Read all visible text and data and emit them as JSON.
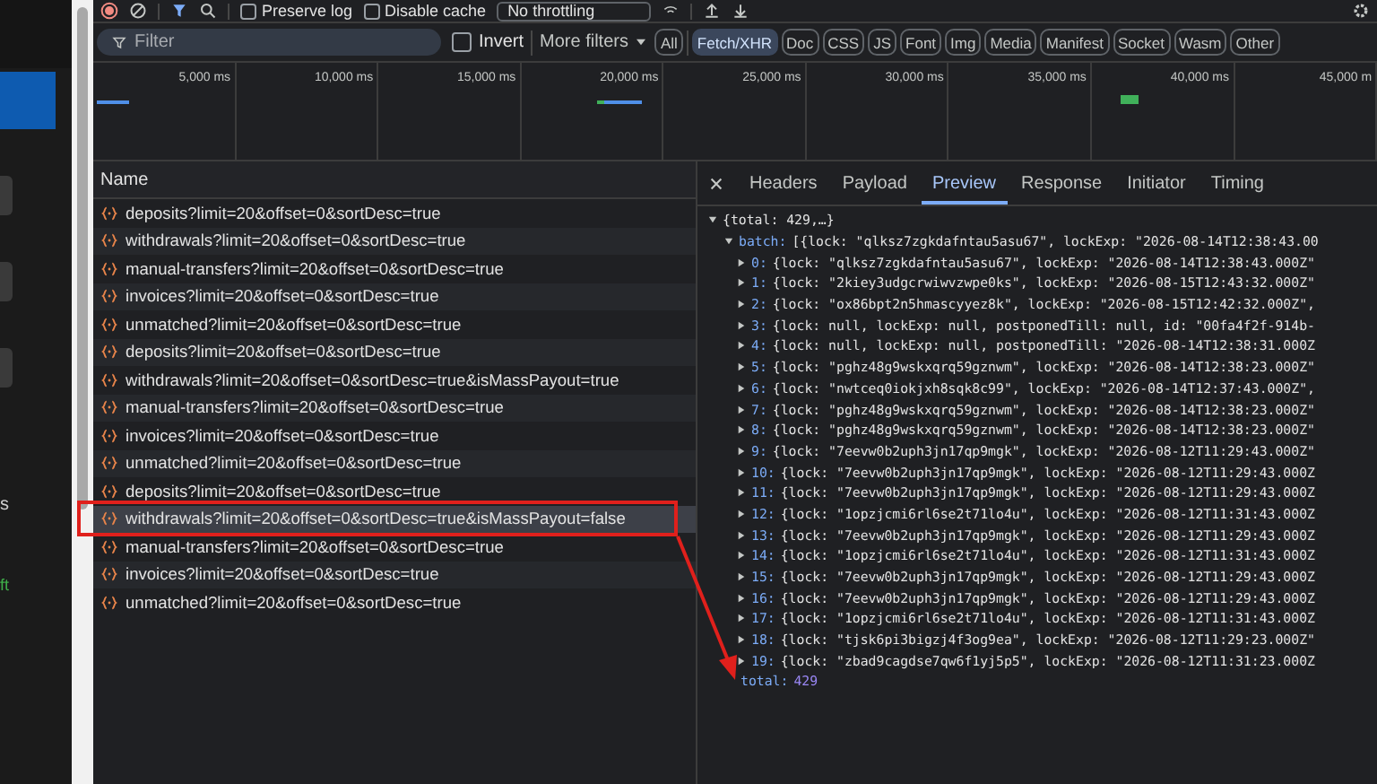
{
  "page_behind": {
    "texts": [
      "s",
      "ft"
    ]
  },
  "toolbar": {
    "checkboxes": [
      {
        "label": "Preserve log",
        "checked": false
      },
      {
        "label": "Disable cache",
        "checked": false
      }
    ],
    "throttling": "No throttling"
  },
  "filter_bar": {
    "placeholder": "Filter",
    "invert": {
      "label": "Invert",
      "checked": false
    },
    "more_filters": "More filters",
    "types": [
      {
        "label": "All",
        "selected": false
      },
      {
        "label": "Fetch/XHR",
        "selected": true
      },
      {
        "label": "Doc",
        "selected": false
      },
      {
        "label": "CSS",
        "selected": false
      },
      {
        "label": "JS",
        "selected": false
      },
      {
        "label": "Font",
        "selected": false
      },
      {
        "label": "Img",
        "selected": false
      },
      {
        "label": "Media",
        "selected": false
      },
      {
        "label": "Manifest",
        "selected": false
      },
      {
        "label": "Socket",
        "selected": false
      },
      {
        "label": "Wasm",
        "selected": false
      },
      {
        "label": "Other",
        "selected": false
      }
    ]
  },
  "timeline": {
    "ticks": [
      "5,000 ms",
      "10,000 ms",
      "15,000 ms",
      "20,000 ms",
      "25,000 ms",
      "30,000 ms",
      "35,000 ms",
      "40,000 ms",
      "45,000 m"
    ]
  },
  "requests": {
    "column": "Name",
    "rows": [
      {
        "name": "deposits?limit=20&offset=0&sortDesc=true",
        "selected": false
      },
      {
        "name": "withdrawals?limit=20&offset=0&sortDesc=true",
        "selected": false
      },
      {
        "name": "manual-transfers?limit=20&offset=0&sortDesc=true",
        "selected": false
      },
      {
        "name": "invoices?limit=20&offset=0&sortDesc=true",
        "selected": false
      },
      {
        "name": "unmatched?limit=20&offset=0&sortDesc=true",
        "selected": false
      },
      {
        "name": "deposits?limit=20&offset=0&sortDesc=true",
        "selected": false
      },
      {
        "name": "withdrawals?limit=20&offset=0&sortDesc=true&isMassPayout=true",
        "selected": false
      },
      {
        "name": "manual-transfers?limit=20&offset=0&sortDesc=true",
        "selected": false
      },
      {
        "name": "invoices?limit=20&offset=0&sortDesc=true",
        "selected": false
      },
      {
        "name": "unmatched?limit=20&offset=0&sortDesc=true",
        "selected": false
      },
      {
        "name": "deposits?limit=20&offset=0&sortDesc=true",
        "selected": false
      },
      {
        "name": "withdrawals?limit=20&offset=0&sortDesc=true&isMassPayout=false",
        "selected": true
      },
      {
        "name": "manual-transfers?limit=20&offset=0&sortDesc=true",
        "selected": false
      },
      {
        "name": "invoices?limit=20&offset=0&sortDesc=true",
        "selected": false
      },
      {
        "name": "unmatched?limit=20&offset=0&sortDesc=true",
        "selected": false
      }
    ]
  },
  "details": {
    "tabs": [
      {
        "label": "Headers",
        "selected": false
      },
      {
        "label": "Payload",
        "selected": false
      },
      {
        "label": "Preview",
        "selected": true
      },
      {
        "label": "Response",
        "selected": false
      },
      {
        "label": "Initiator",
        "selected": false
      },
      {
        "label": "Timing",
        "selected": false
      }
    ],
    "preview": {
      "root": {
        "text": "{total: 429,…}",
        "expanded": true
      },
      "batch": {
        "key": "batch:",
        "value": "[{lock: \"qlksz7zgkdafntau5asu67\", lockExp: \"2026-08-14T12:38:43.00",
        "expanded": true
      },
      "items": [
        {
          "key": "0:",
          "value": "{lock: \"qlksz7zgkdafntau5asu67\", lockExp: \"2026-08-14T12:38:43.000Z\"",
          "expanded": false
        },
        {
          "key": "1:",
          "value": "{lock: \"2kiey3udgcrwiwvzwpe0ks\", lockExp: \"2026-08-15T12:43:32.000Z\"",
          "expanded": false
        },
        {
          "key": "2:",
          "value": "{lock: \"ox86bpt2n5hmascyyez8k\", lockExp: \"2026-08-15T12:42:32.000Z\",",
          "expanded": false
        },
        {
          "key": "3:",
          "value": "{lock: null, lockExp: null, postponedTill: null, id: \"00fa4f2f-914b-",
          "expanded": false
        },
        {
          "key": "4:",
          "value": "{lock: null, lockExp: null, postponedTill: \"2026-08-14T12:38:31.000Z",
          "expanded": false
        },
        {
          "key": "5:",
          "value": "{lock: \"pghz48g9wskxqrq59gznwm\", lockExp: \"2026-08-14T12:38:23.000Z\"",
          "expanded": false
        },
        {
          "key": "6:",
          "value": "{lock: \"nwtceq0iokjxh8sqk8c99\", lockExp: \"2026-08-14T12:37:43.000Z\",",
          "expanded": false
        },
        {
          "key": "7:",
          "value": "{lock: \"pghz48g9wskxqrq59gznwm\", lockExp: \"2026-08-14T12:38:23.000Z\"",
          "expanded": false
        },
        {
          "key": "8:",
          "value": "{lock: \"pghz48g9wskxqrq59gznwm\", lockExp: \"2026-08-14T12:38:23.000Z\"",
          "expanded": false
        },
        {
          "key": "9:",
          "value": "{lock: \"7eevw0b2uph3jn17qp9mgk\", lockExp: \"2026-08-12T11:29:43.000Z\"",
          "expanded": false
        },
        {
          "key": "10:",
          "value": "{lock: \"7eevw0b2uph3jn17qp9mgk\", lockExp: \"2026-08-12T11:29:43.000Z",
          "expanded": false
        },
        {
          "key": "11:",
          "value": "{lock: \"7eevw0b2uph3jn17qp9mgk\", lockExp: \"2026-08-12T11:29:43.000Z",
          "expanded": false
        },
        {
          "key": "12:",
          "value": "{lock: \"1opzjcmi6rl6se2t71lo4u\", lockExp: \"2026-08-12T11:31:43.000Z",
          "expanded": false
        },
        {
          "key": "13:",
          "value": "{lock: \"7eevw0b2uph3jn17qp9mgk\", lockExp: \"2026-08-12T11:29:43.000Z",
          "expanded": false
        },
        {
          "key": "14:",
          "value": "{lock: \"1opzjcmi6rl6se2t71lo4u\", lockExp: \"2026-08-12T11:31:43.000Z",
          "expanded": false
        },
        {
          "key": "15:",
          "value": "{lock: \"7eevw0b2uph3jn17qp9mgk\", lockExp: \"2026-08-12T11:29:43.000Z",
          "expanded": false
        },
        {
          "key": "16:",
          "value": "{lock: \"7eevw0b2uph3jn17qp9mgk\", lockExp: \"2026-08-12T11:29:43.000Z",
          "expanded": false
        },
        {
          "key": "17:",
          "value": "{lock: \"1opzjcmi6rl6se2t71lo4u\", lockExp: \"2026-08-12T11:31:43.000Z",
          "expanded": false
        },
        {
          "key": "18:",
          "value": "{lock: \"tjsk6pi3bigzj4f3og9ea\", lockExp: \"2026-08-12T11:29:23.000Z\"",
          "expanded": false
        },
        {
          "key": "19:",
          "value": "{lock: \"zbad9cagdse7qw6f1yj5p5\", lockExp: \"2026-08-12T11:31:23.000Z",
          "expanded": false
        }
      ],
      "footer": {
        "key": "total:",
        "value": "429"
      }
    }
  }
}
